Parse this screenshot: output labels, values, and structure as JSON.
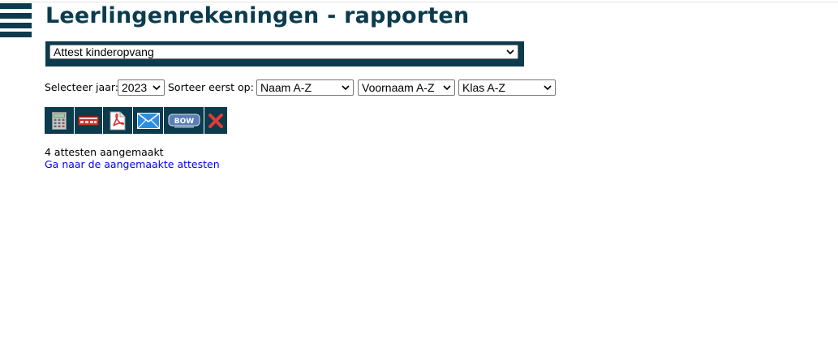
{
  "header": {
    "title": "Leerlingenrekeningen - rapporten",
    "menu_icon": "hamburger-menu-icon"
  },
  "report_select": {
    "selected": "Attest kinderopvang"
  },
  "filters": {
    "year_label": "Selecteer jaar:",
    "year_selected": "2023",
    "sort_label": "Sorteer eerst op:",
    "sort1_selected": "Naam A-Z",
    "sort2_selected": "Voornaam A-Z",
    "sort3_selected": "Klas A-Z"
  },
  "toolbar": {
    "buttons": [
      {
        "icon": "calculator-icon"
      },
      {
        "icon": "card-export-icon"
      },
      {
        "icon": "pdf-icon"
      },
      {
        "icon": "mail-icon"
      },
      {
        "icon": "bow-logo-icon",
        "text": "BOW"
      },
      {
        "icon": "close-icon"
      }
    ]
  },
  "result": {
    "status": "4 attesten aangemaakt",
    "link": "Ga naar de aangemaakte attesten"
  },
  "colors": {
    "brand": "#0b3b4c",
    "link": "#0000ee",
    "close": "#e53935"
  }
}
